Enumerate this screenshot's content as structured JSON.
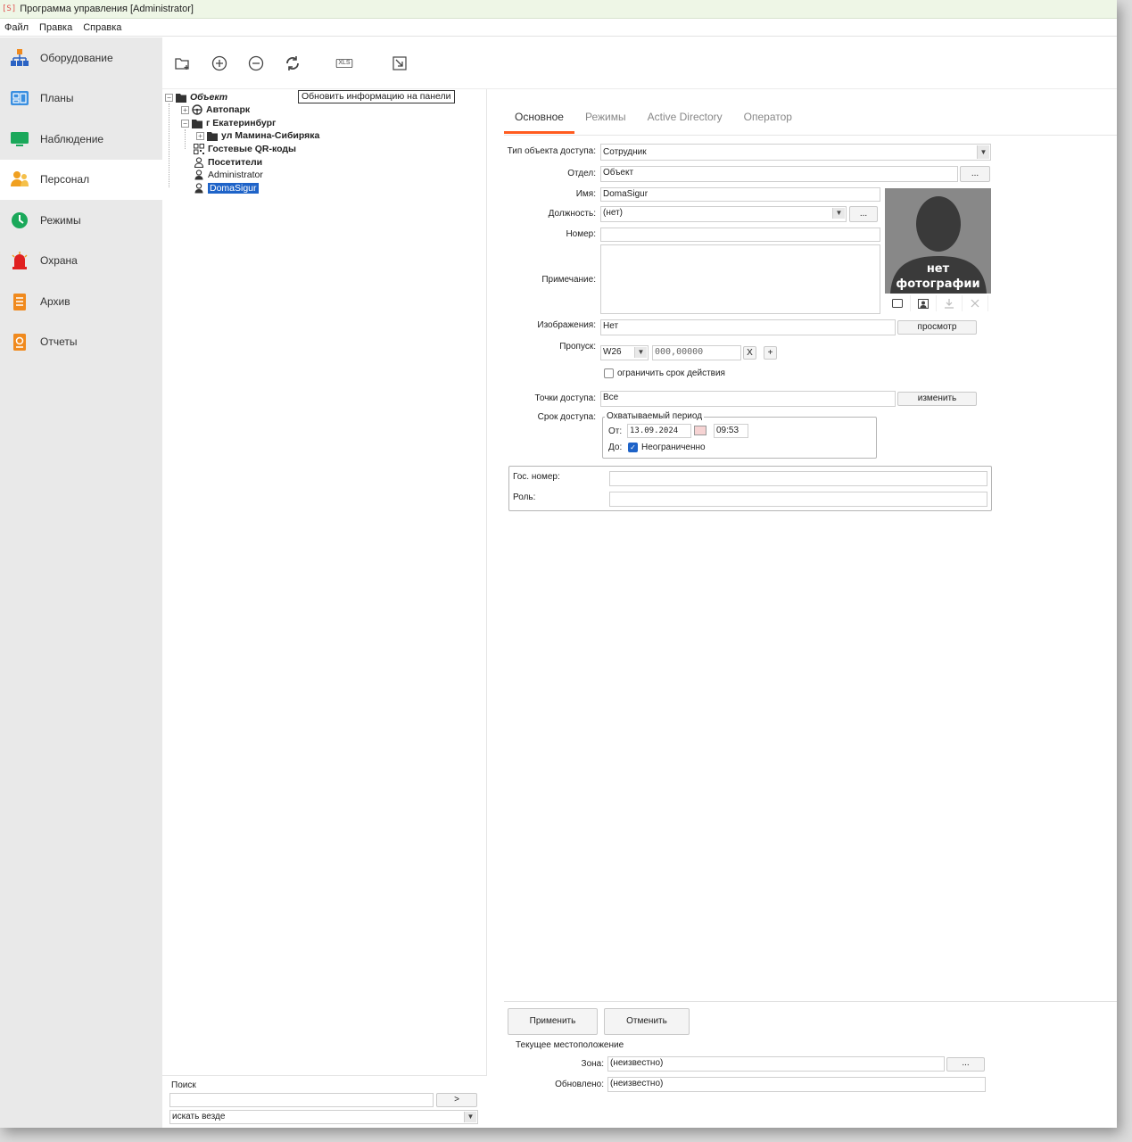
{
  "window": {
    "badge": "[S]",
    "title": "Программа управления [Administrator]"
  },
  "menu": [
    "Файл",
    "Правка",
    "Справка"
  ],
  "sidebar": {
    "items": [
      {
        "label": "Оборудование",
        "icon": "network-icon"
      },
      {
        "label": "Планы",
        "icon": "floorplan-icon"
      },
      {
        "label": "Наблюдение",
        "icon": "monitor-icon"
      },
      {
        "label": "Персонал",
        "icon": "people-icon"
      },
      {
        "label": "Режимы",
        "icon": "clock-icon"
      },
      {
        "label": "Охрана",
        "icon": "siren-icon"
      },
      {
        "label": "Архив",
        "icon": "archive-icon"
      },
      {
        "label": "Отчеты",
        "icon": "report-icon"
      }
    ],
    "active_index": 3
  },
  "toolbar": {
    "tooltip": "Обновить информацию на панели",
    "xls_label": "XLS"
  },
  "tree": {
    "root": "Объект",
    "autopark": "Автопарк",
    "city": "г Екатеринбург",
    "street": "ул Мамина-Сибиряка",
    "qr": "Гостевые QR-коды",
    "visitors": "Посетители",
    "admin": "Administrator",
    "selected": "DomaSigur"
  },
  "search": {
    "label": "Поиск",
    "value": "",
    "go_label": ">",
    "scope": "искать везде"
  },
  "tabs": [
    "Основное",
    "Режимы",
    "Active Directory",
    "Оператор"
  ],
  "form": {
    "type_label": "Тип объекта доступа:",
    "type_value": "Сотрудник",
    "dept_label": "Отдел:",
    "dept_value": "Объект",
    "name_label": "Имя:",
    "name_value": "DomaSigur",
    "position_label": "Должность:",
    "position_value": "(нет)",
    "number_label": "Номер:",
    "number_value": "",
    "note_label": "Примечание:",
    "note_value": "",
    "images_label": "Изображения:",
    "images_value": "Нет",
    "view_label": "просмотр",
    "pass_label": "Пропуск:",
    "pass_format": "W26",
    "pass_value": "000,00000",
    "pass_clear": "X",
    "pass_add": "+",
    "limit_label": "ограничить срок действия",
    "points_label": "Точки доступа:",
    "points_value": "Все",
    "change_label": "изменить",
    "term_label": "Срок доступа:",
    "period_legend": "Охватываемый период",
    "from_label": "От:",
    "from_date": "13.09.2024",
    "from_time": "09:53",
    "to_label": "До:",
    "to_value": "Неограниченно",
    "plate_label": "Гос. номер:",
    "plate_value": "",
    "role_label": "Роль:",
    "role_value": "",
    "ellipsis": "..."
  },
  "photo": {
    "line1": "нет",
    "line2": "фотографии"
  },
  "actions": {
    "apply": "Применить",
    "cancel": "Отменить",
    "location_title": "Текущее местоположение",
    "zone_label": "Зона:",
    "zone_value": "(неизвестно)",
    "updated_label": "Обновлено:",
    "updated_value": "(неизвестно)"
  },
  "colors": {
    "accent": "#ff5b1f",
    "selection": "#1e63c8",
    "sidebar": "#e9e9e9"
  }
}
